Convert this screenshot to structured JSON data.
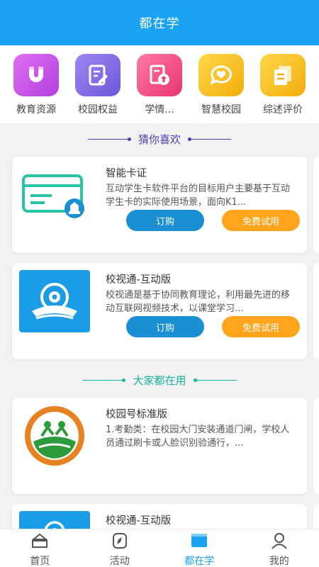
{
  "header": {
    "title": "都在学"
  },
  "quicknav": [
    {
      "label": "教育资源",
      "icon": "magnet-icon",
      "color": "#c650e6"
    },
    {
      "label": "校园权益",
      "icon": "edit-document-icon",
      "color": "#8c6de8"
    },
    {
      "label": "学情...",
      "icon": "upload-document-icon",
      "color": "#f2508a"
    },
    {
      "label": "智慧校园",
      "icon": "heart-chat-icon",
      "color": "#f9c11c"
    },
    {
      "label": "综述评价",
      "icon": "documents-icon",
      "color": "#fbc31b"
    }
  ],
  "sections": {
    "guess": {
      "title": "猜你喜欢",
      "color": "#4a3fb0"
    },
    "popular": {
      "title": "大家都在用",
      "color": "#16b39a"
    }
  },
  "cards": [
    {
      "title": "智能卡证",
      "desc": "互动学生卡软件平台的目标用户主要基于互动学生卡的实际使用场景，面向K1...",
      "buy_label": "订购",
      "try_label": "免费试用",
      "icon": "smart-card-icon"
    },
    {
      "title": "校视通-互动版",
      "desc": "校视通是基于协同教育理论，利用最先进的移动互联网视频技术，以课堂学习...",
      "buy_label": "订购",
      "try_label": "免费试用",
      "icon": "video-camera-icon"
    },
    {
      "title": "校园号标准版",
      "desc": "1.考勤类：在校园大门安装通道门闸，学校人员通过刷卡或人脸识别验通行，...",
      "icon": "school-badge-icon"
    },
    {
      "title": "校视通-互动版",
      "icon": "video-camera-icon"
    }
  ],
  "tabbar": [
    {
      "label": "首页",
      "icon": "home-icon",
      "active": false
    },
    {
      "label": "活动",
      "icon": "compass-icon",
      "active": false
    },
    {
      "label": "都在学",
      "icon": "learn-icon",
      "active": true
    },
    {
      "label": "我的",
      "icon": "user-icon",
      "active": false
    }
  ]
}
